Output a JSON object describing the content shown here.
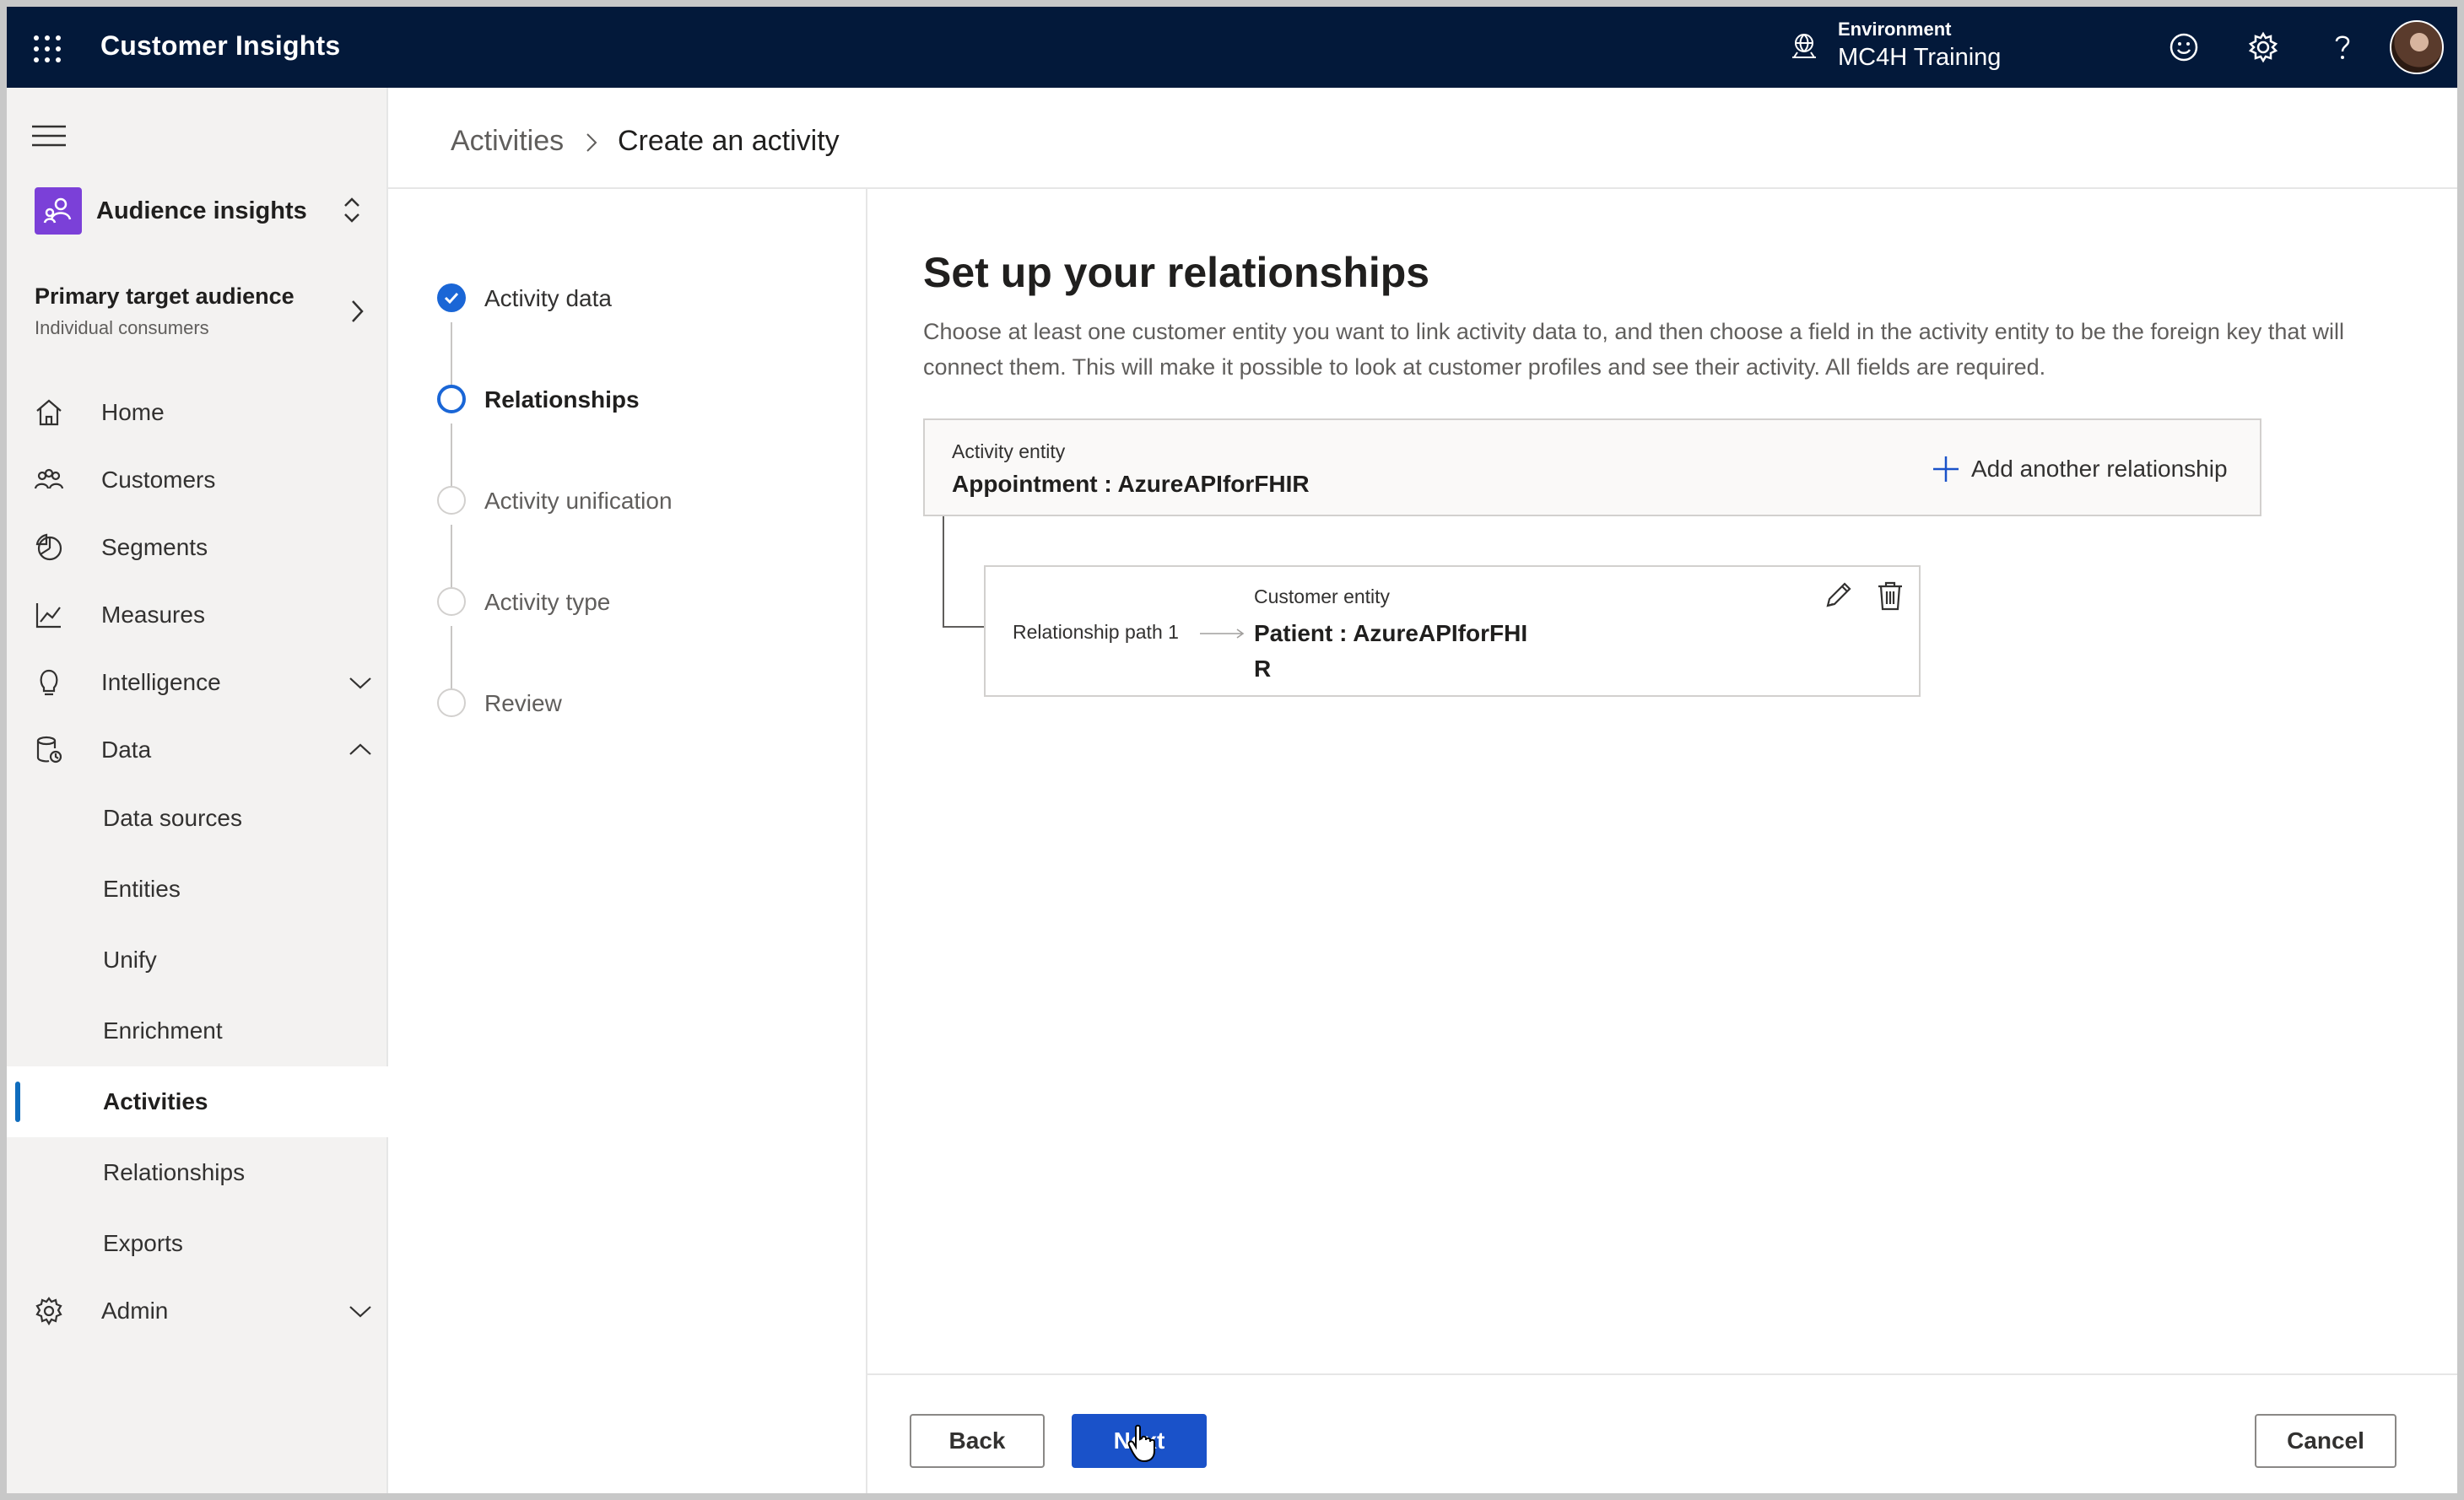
{
  "header": {
    "app_title": "Customer Insights",
    "environment_label": "Environment",
    "environment_value": "MC4H Training",
    "icons": [
      "waffle-icon",
      "environment-icon",
      "feedback-smiley-icon",
      "settings-gear-icon",
      "help-icon",
      "user-avatar"
    ]
  },
  "sidebar": {
    "app_switcher": "Audience insights",
    "audience_title": "Primary target audience",
    "audience_subtitle": "Individual consumers",
    "items": [
      {
        "label": "Home",
        "icon": "home-icon"
      },
      {
        "label": "Customers",
        "icon": "customers-icon"
      },
      {
        "label": "Segments",
        "icon": "segments-icon"
      },
      {
        "label": "Measures",
        "icon": "measures-icon"
      },
      {
        "label": "Intelligence",
        "icon": "lightbulb-icon",
        "expandable": true,
        "expanded": false
      },
      {
        "label": "Data",
        "icon": "data-icon",
        "expandable": true,
        "expanded": true
      },
      {
        "label": "Admin",
        "icon": "gear-icon",
        "expandable": true,
        "expanded": false
      }
    ],
    "data_subitems": [
      "Data sources",
      "Entities",
      "Unify",
      "Enrichment",
      "Activities",
      "Relationships",
      "Exports"
    ],
    "active_item": "Activities"
  },
  "breadcrumb": {
    "parent": "Activities",
    "current": "Create an activity"
  },
  "steps": [
    {
      "label": "Activity data",
      "state": "done"
    },
    {
      "label": "Relationships",
      "state": "current"
    },
    {
      "label": "Activity unification",
      "state": "pending"
    },
    {
      "label": "Activity type",
      "state": "pending"
    },
    {
      "label": "Review",
      "state": "pending"
    }
  ],
  "main": {
    "heading": "Set up your relationships",
    "description": "Choose at least one customer entity you want to link activity data to, and then choose a field in the activity entity to be the foreign key that will connect them. This will make it possible to look at customer profiles and see their activity. All fields are required.",
    "activity_entity_label": "Activity entity",
    "activity_entity_value": "Appointment : AzureAPIforFHIR",
    "add_relationship": "Add another relationship",
    "relationship": {
      "path_label": "Relationship path 1",
      "customer_entity_label": "Customer entity",
      "customer_entity_value": "Patient : AzureAPIforFHIR"
    }
  },
  "footer": {
    "back": "Back",
    "next": "Next",
    "cancel": "Cancel"
  },
  "colors": {
    "topbar": "#03193a",
    "accent": "#1a52c9",
    "app_icon": "#7b40d8"
  }
}
